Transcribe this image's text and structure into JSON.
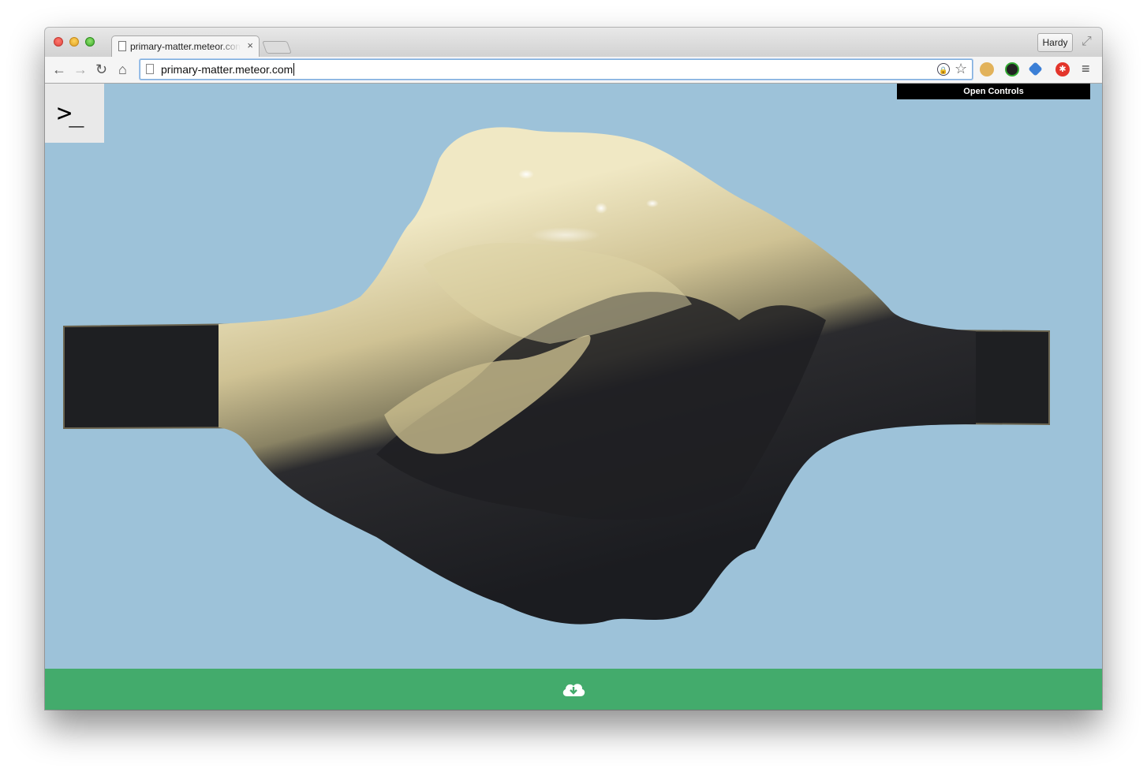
{
  "browser": {
    "tab_title": "primary-matter.meteor.com",
    "tab_close": "×",
    "profile_name": "Hardy",
    "url": "primary-matter.meteor.com"
  },
  "page": {
    "console_glyph": ">_",
    "open_controls_label": "Open Controls"
  },
  "colors": {
    "sky": "#9dc2d9",
    "bottom_bar": "#43ab6c",
    "blob_light": "#e8dfb0",
    "blob_dark": "#1e1f22"
  }
}
